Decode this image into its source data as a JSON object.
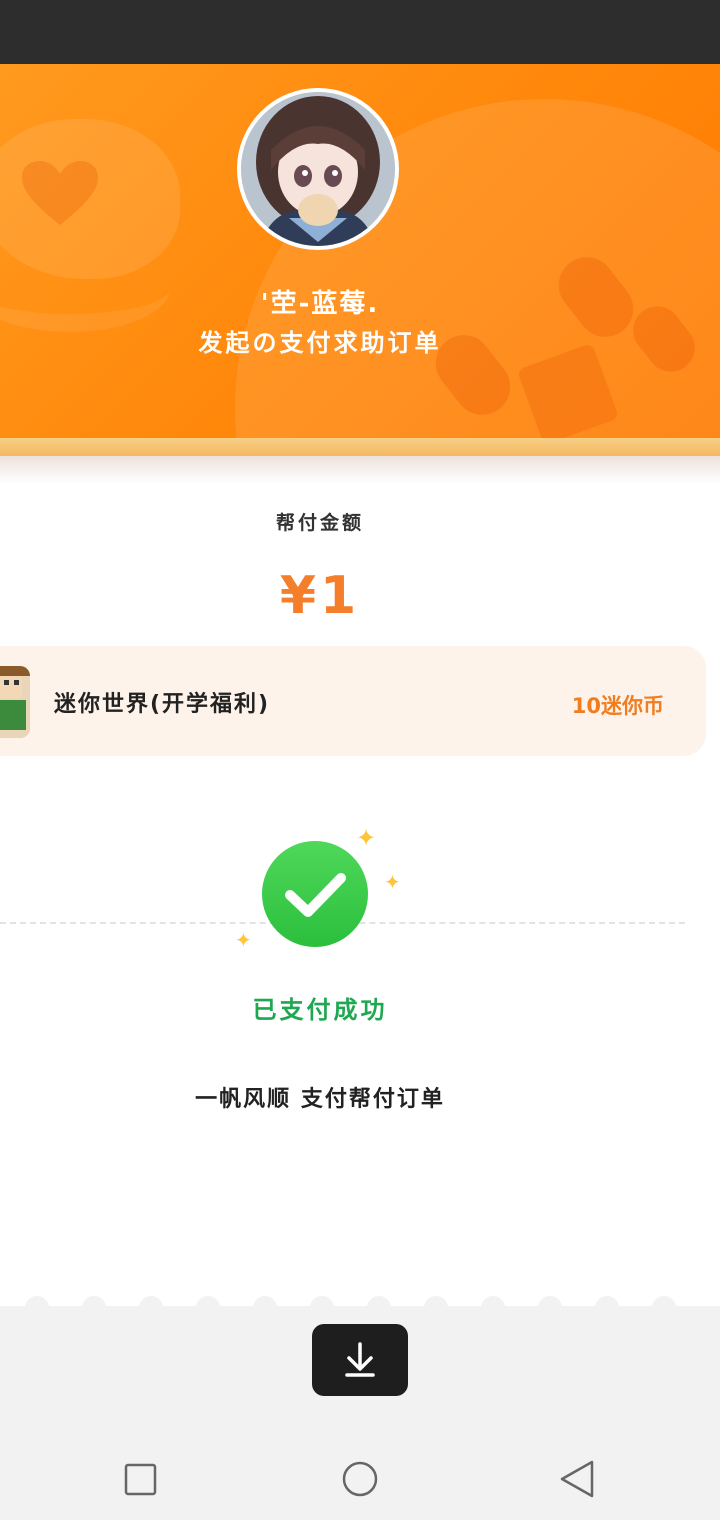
{
  "header": {
    "user_name": "'茔-蓝莓.",
    "order_caption": "发起の支付求助订单"
  },
  "payment": {
    "amount_label": "帮付金额",
    "amount_value": "¥1"
  },
  "product": {
    "name": "迷你世界(开学福利)",
    "price": "10迷你币"
  },
  "status": {
    "success_text": "已支付成功",
    "footer_text": "一帆风顺 支付帮付订单"
  },
  "icons": {
    "download": "download-icon",
    "success": "checkmark-icon",
    "nav_recent": "square-icon",
    "nav_home": "circle-icon",
    "nav_back": "triangle-back-icon"
  },
  "colors": {
    "brand_orange": "#ff8a0d",
    "amount": "#f57e2a",
    "success_green": "#2bbf3c"
  }
}
